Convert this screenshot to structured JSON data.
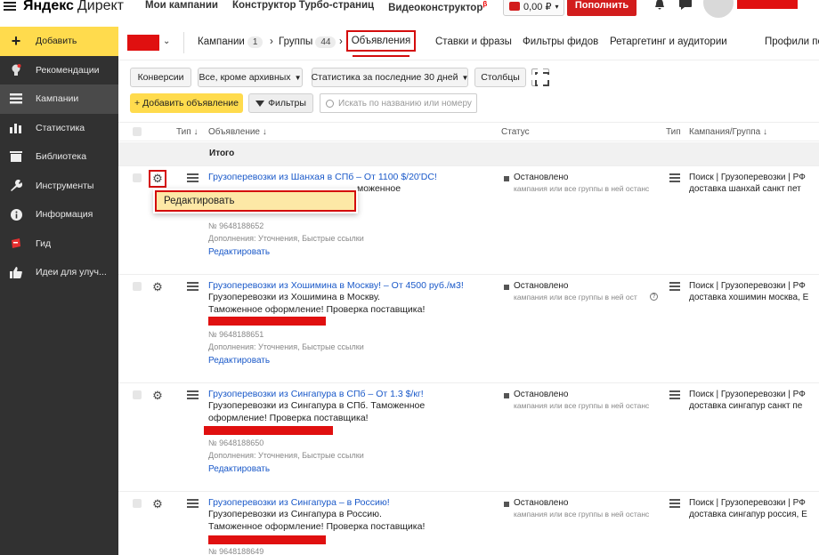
{
  "header": {
    "logo_brand": "Яндекс",
    "logo_product": "Директ",
    "nav": [
      "Мои кампании",
      "Конструктор Турбо-страниц",
      "Видеоконструктор"
    ],
    "nav_badge": "β",
    "balance": "0,00 ₽",
    "topup_label": "Пополнить"
  },
  "sidebar": {
    "items": [
      {
        "label": "Добавить",
        "icon": "plus-icon"
      },
      {
        "label": "Рекомендации",
        "icon": "lightbulb-icon"
      },
      {
        "label": "Кампании",
        "icon": "list-icon"
      },
      {
        "label": "Статистика",
        "icon": "bar-chart-icon"
      },
      {
        "label": "Библиотека",
        "icon": "library-icon"
      },
      {
        "label": "Инструменты",
        "icon": "wrench-icon"
      },
      {
        "label": "Информация",
        "icon": "info-icon"
      },
      {
        "label": "Гид",
        "icon": "guide-icon"
      },
      {
        "label": "Идеи для улуч...",
        "icon": "thumbs-up-icon"
      }
    ]
  },
  "breadcrumbs": {
    "campaigns_label": "Кампании",
    "campaigns_count": "1",
    "groups_label": "Группы",
    "groups_count": "44",
    "separator": "›",
    "active_tab": "Объявления",
    "tabs": [
      "Ставки и фразы",
      "Фильтры фидов",
      "Ретаргетинг и аудитории",
      "Профили пол"
    ]
  },
  "toolbar": {
    "conversions": "Конверсии",
    "archive_filter": "Все, кроме архивных",
    "period": "Статистика за последние 30 дней",
    "columns": "Столбцы",
    "add_ad": "+ Добавить объявление",
    "filters": "Фильтры",
    "search_placeholder": "Искать по названию или номеру"
  },
  "table": {
    "headers": {
      "type": "Тип ↓",
      "ad": "Объявление ↓",
      "status": "Статус",
      "type2": "Тип",
      "campaign": "Кампания/Группа ↓"
    },
    "total_label": "Итого",
    "rows": [
      {
        "title": "Грузоперевозки из Шанхая в СПб – От 1100 $/20'DC!",
        "text1": "моженное",
        "text2": "",
        "number": "№ 9648188652",
        "extensions": "Дополнения: Уточнения, Быстрые ссылки",
        "edit": "Редактировать",
        "status": "Остановлено",
        "status_sub": "кампания или все группы в ней останс",
        "campaign1": "Поиск | Грузоперевозки | РФ",
        "campaign2": "доставка шанхай санкт пет"
      },
      {
        "title": "Грузоперевозки из Хошимина в Москву! – От 4500 руб./м3!",
        "text1": "Грузоперевозки из Хошимина в Москву.",
        "text2": "Таможенное оформление! Проверка поставщика!",
        "number": "№ 9648188651",
        "extensions": "Дополнения: Уточнения, Быстрые ссылки",
        "edit": "Редактировать",
        "status": "Остановлено",
        "status_sub": "кампания или все группы в ней ост",
        "campaign1": "Поиск | Грузоперевозки | РФ",
        "campaign2": "доставка хошимин москва, Е"
      },
      {
        "title": "Грузоперевозки из Сингапура в СПб – От 1.3 $/кг!",
        "text1": "Грузоперевозки из Сингапура в СПб. Таможенное",
        "text2": "оформление! Проверка поставщика!",
        "number": "№ 9648188650",
        "extensions": "Дополнения: Уточнения, Быстрые ссылки",
        "edit": "Редактировать",
        "status": "Остановлено",
        "status_sub": "кампания или все группы в ней останс",
        "campaign1": "Поиск | Грузоперевозки | РФ",
        "campaign2": "доставка сингапур санкт пе"
      },
      {
        "title": "Грузоперевозки из Сингапура – в Россию!",
        "text1": "Грузоперевозки из Сингапура в Россию.",
        "text2": "Таможенное оформление! Проверка поставщика!",
        "number": "№ 9648188649",
        "extensions": "",
        "edit": "",
        "status": "Остановлено",
        "status_sub": "кампания или все группы в ней останс",
        "campaign1": "Поиск | Грузоперевозки | РФ",
        "campaign2": "доставка сингапур россия, Е"
      }
    ]
  },
  "popup": {
    "edit_label": "Редактировать"
  },
  "colors": {
    "accent_yellow": "#ffdb4d",
    "brand_red": "#d21c1c",
    "link_blue": "#1a59c9",
    "sidebar_bg": "#313131"
  }
}
